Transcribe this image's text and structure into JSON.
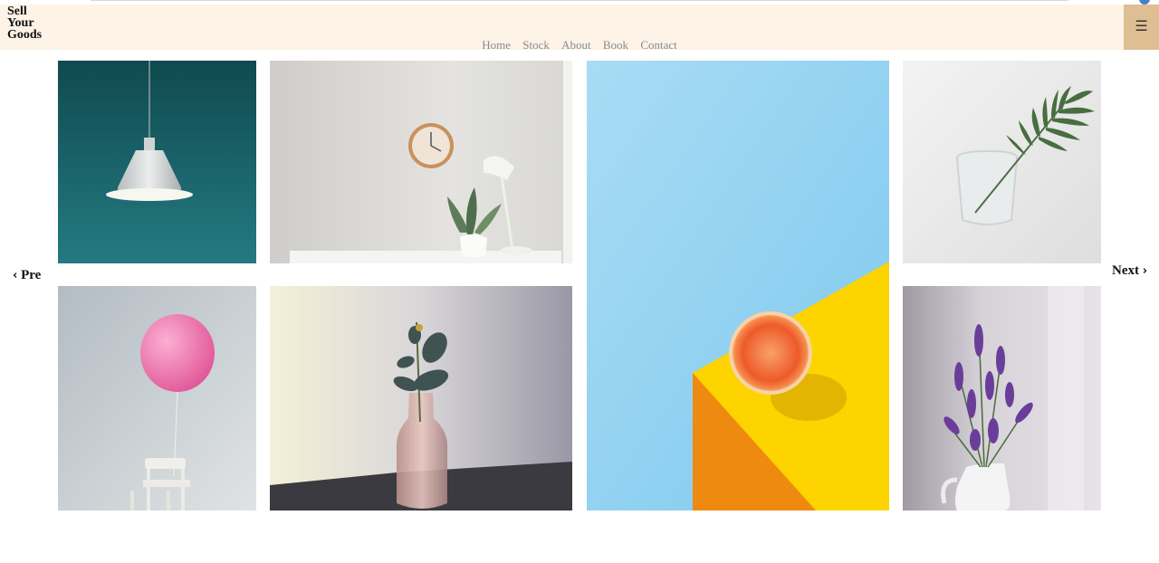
{
  "header": {
    "brand_lines": [
      "Sell",
      "Your",
      "Goods"
    ],
    "menu_icon": "☰"
  },
  "nav": {
    "items": [
      "Home",
      "Stock",
      "About",
      "Book",
      "Contact"
    ]
  },
  "gallery": {
    "prev_label": "Pre",
    "next_label": "Next",
    "prev_icon": "chevron-left-icon",
    "next_icon": "chevron-right-icon",
    "images": [
      "pendant-lamp-on-teal-wall",
      "wall-clock-desk-lamp-and-plant",
      "grapefruit-half-on-yellow-block",
      "leaf-in-glass-of-water",
      "pink-balloon-on-white-chair",
      "eucalyptus-in-pink-glass-vase",
      "lavender-in-white-pitcher"
    ]
  },
  "colors": {
    "header_bg": "#fdf3e7",
    "menu_button_bg": "#dfbe93",
    "nav_text": "#8a8a8a"
  }
}
